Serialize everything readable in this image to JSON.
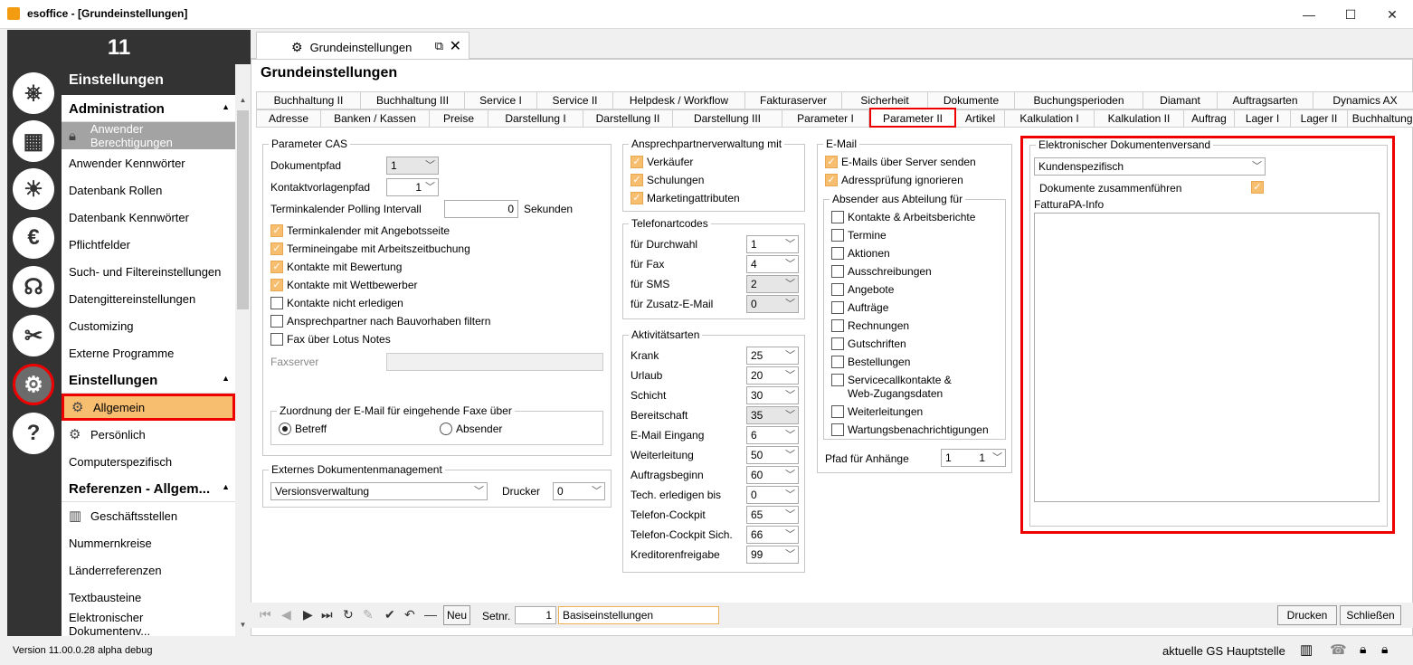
{
  "window": {
    "title": "esoffice - [Grundeinstellungen]",
    "min": "—",
    "max": "☐",
    "close": "✕"
  },
  "rail": {
    "number": "11",
    "icons": [
      "⎈",
      "▦",
      "☀",
      "€",
      "☊",
      "✂",
      "⚙",
      "?"
    ]
  },
  "sidebar": {
    "header": "Einstellungen",
    "sections": [
      {
        "title": "Administration",
        "arrow": "▲",
        "items": [
          "Anwender Berechtigungen",
          "Anwender Kennwörter",
          "Datenbank Rollen",
          "Datenbank Kennwörter",
          "Pflichtfelder",
          "Such- und Filtereinstellungen",
          "Datengittereinstellungen",
          "Customizing",
          "Externe Programme"
        ]
      },
      {
        "title": "Einstellungen",
        "arrow": "▲",
        "items": [
          "Allgemein",
          "Persönlich",
          "Computerspezifisch"
        ]
      },
      {
        "title": "Referenzen - Allgem...",
        "arrow": "▲",
        "items": [
          "Geschäftsstellen",
          "Nummernkreise",
          "Länderreferenzen",
          "Textbausteine",
          "Elektronischer Dokumentenv..."
        ]
      }
    ]
  },
  "doc_tab": {
    "label": "Grundeinstellungen"
  },
  "page_title": "Grundeinstellungen",
  "tabs_row1": [
    "Buchhaltung II",
    "Buchhaltung III",
    "Service I",
    "Service II",
    "Helpdesk / Workflow",
    "Fakturaserver",
    "Sicherheit",
    "Dokumente",
    "Buchungsperioden",
    "Diamant",
    "Auftragsarten",
    "Dynamics AX"
  ],
  "tabs_row2": [
    "Adresse",
    "Banken / Kassen",
    "Preise",
    "Darstellung I",
    "Darstellung II",
    "Darstellung III",
    "Parameter I",
    "Parameter II",
    "Artikel",
    "Kalkulation I",
    "Kalkulation II",
    "Auftrag",
    "Lager I",
    "Lager II",
    "Buchhaltung I"
  ],
  "cas": {
    "title": "Parameter CAS",
    "dokumentpfad_label": "Dokumentpfad",
    "dokumentpfad_value": "1",
    "kontaktvorlagenpfad_label": "Kontaktvorlagenpfad",
    "kontaktvorlagenpfad_value": "1",
    "polling_label": "Terminkalender Polling Intervall",
    "polling_value": "0",
    "polling_unit": "Sekunden",
    "checkboxes": [
      {
        "label": "Terminkalender mit Angebotsseite",
        "checked": true
      },
      {
        "label": "Termineingabe mit Arbeitszeitbuchung",
        "checked": true
      },
      {
        "label": "Kontakte mit Bewertung",
        "checked": true
      },
      {
        "label": "Kontakte mit Wettbewerber",
        "checked": true
      },
      {
        "label": "Kontakte nicht erledigen",
        "checked": false
      },
      {
        "label": "Ansprechpartner nach Bauvorhaben filtern",
        "checked": false
      },
      {
        "label": "Fax über Lotus Notes",
        "checked": false
      }
    ],
    "faxserver_label": "Faxserver",
    "faxserver_value": "",
    "fax_group_title": "Zuordnung der E-Mail für eingehende Faxe über",
    "radio_betreff": "Betreff",
    "radio_absender": "Absender"
  },
  "dms": {
    "title": "Externes Dokumentenmanagement",
    "value": "Versionsverwaltung",
    "drucker_label": "Drucker",
    "drucker_value": "0"
  },
  "ansprech": {
    "title": "Ansprechpartnerverwaltung mit",
    "items": [
      {
        "label": "Verkäufer",
        "checked": true
      },
      {
        "label": "Schulungen",
        "checked": true
      },
      {
        "label": "Marketingattributen",
        "checked": true
      }
    ]
  },
  "telefon": {
    "title": "Telefonartcodes",
    "rows": [
      {
        "label": "für Durchwahl",
        "value": "1",
        "gray": false
      },
      {
        "label": "für Fax",
        "value": "4",
        "gray": false
      },
      {
        "label": "für SMS",
        "value": "2",
        "gray": true
      },
      {
        "label": "für Zusatz-E-Mail",
        "value": "0",
        "gray": true
      }
    ]
  },
  "aktivitaet": {
    "title": "Aktivitätsarten",
    "rows": [
      {
        "label": "Krank",
        "value": "25",
        "gray": false
      },
      {
        "label": "Urlaub",
        "value": "20",
        "gray": false
      },
      {
        "label": "Schicht",
        "value": "30",
        "gray": false
      },
      {
        "label": "Bereitschaft",
        "value": "35",
        "gray": true
      },
      {
        "label": "E-Mail Eingang",
        "value": "6",
        "gray": false
      },
      {
        "label": "Weiterleitung",
        "value": "50",
        "gray": false
      },
      {
        "label": "Auftragsbeginn",
        "value": "60",
        "gray": false
      },
      {
        "label": "Tech. erledigen bis",
        "value": "0",
        "gray": false
      },
      {
        "label": "Telefon-Cockpit",
        "value": "65",
        "gray": false
      },
      {
        "label": "Telefon-Cockpit Sich.",
        "value": "66",
        "gray": false
      },
      {
        "label": "Kreditorenfreigabe",
        "value": "99",
        "gray": false
      }
    ]
  },
  "email": {
    "title": "E-Mail",
    "items": [
      {
        "label": "E-Mails über Server senden",
        "checked": true
      },
      {
        "label": "Adressprüfung ignorieren",
        "checked": true
      }
    ],
    "absender_title": "Absender aus Abteilung für",
    "absender": [
      "Kontakte & Arbeitsberichte",
      "Termine",
      "Aktionen",
      "Ausschreibungen",
      "Angebote",
      "Aufträge",
      "Rechnungen",
      "Gutschriften",
      "Bestellungen",
      "Servicecallkontakte &",
      "Weiterleitungen",
      "Wartungsbenachrichtigungen"
    ],
    "absender_line2": "Web-Zugangsdaten",
    "pfad_label": "Pfad für Anhänge",
    "pfad_value1": "1",
    "pfad_value2": "1"
  },
  "edv": {
    "title": "Elektronischer Dokumentenversand",
    "select_value": "Kundenspezifisch",
    "zusammen_label": "Dokumente zusammenführen",
    "zusammen_checked": true,
    "fattura_label": "FatturaPA-Info"
  },
  "bottom": {
    "neu": "Neu",
    "setnr_label": "Setnr.",
    "setnr_value": "1",
    "basis_value": "Basiseinstellungen",
    "drucken": "Drucken",
    "schliessen": "Schließen"
  },
  "status": {
    "version": "Version  11.00.0.28 alpha debug",
    "gs": "aktuelle GS  Hauptstelle"
  }
}
